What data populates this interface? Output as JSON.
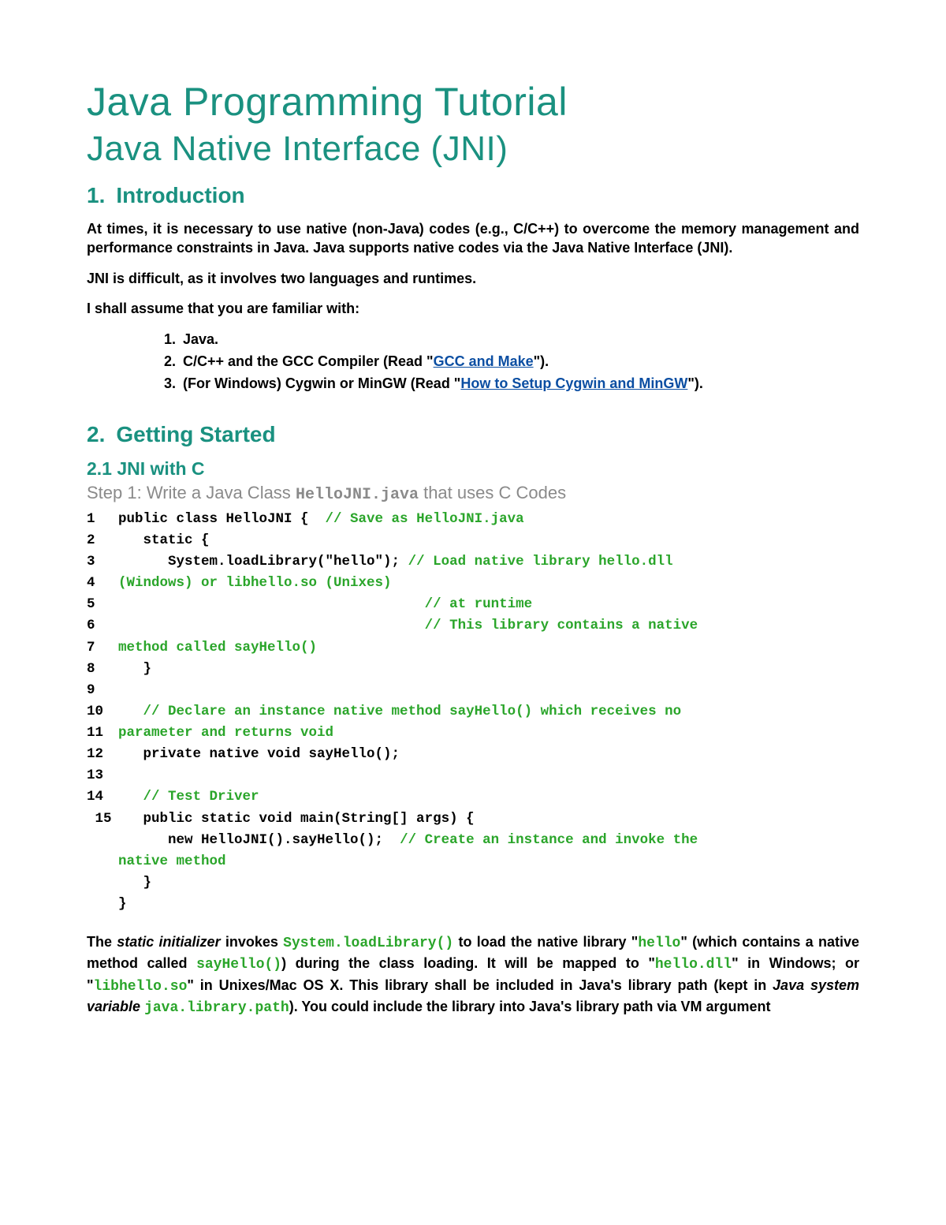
{
  "title": "Java Programming Tutorial",
  "subtitle": "Java Native Interface (JNI)",
  "section1": {
    "num": "1.",
    "label": "Introduction"
  },
  "intro": {
    "p1": "At times, it is necessary to use native (non-Java) codes (e.g., C/C++) to overcome the memory management and performance constraints in Java. Java supports native codes via the Java Native Interface (JNI).",
    "p2": "JNI is difficult, as it involves two languages and runtimes.",
    "p3": "I shall assume that you are familiar with:"
  },
  "prereq": {
    "i1": "Java.",
    "i2a": "C/C++ and the GCC Compiler (Read \"",
    "i2link": "GCC and Make",
    "i2b": "\").",
    "i3a": "(For Windows) Cygwin or MinGW (Read \"",
    "i3link": "How to Setup Cygwin and MinGW",
    "i3b": "\")."
  },
  "section2": {
    "num": "2.",
    "label": "Getting Started"
  },
  "sub21": "2.1  JNI with C",
  "step1": {
    "pre": "Step 1: Write a Java Class ",
    "code": "HelloJNI.java",
    "post": " that uses C Codes"
  },
  "code": {
    "l1a": "public class HelloJNI {  ",
    "l1b": "// Save as HelloJNI.java",
    "l2": "   static {",
    "l3a": "      System.loadLibrary(\"hello\"); ",
    "l3b": "// Load native library hello.dll",
    "l4": "(Windows) or libhello.so (Unixes)",
    "l5": "                                     // at runtime",
    "l6": "                                     // This library contains a native",
    "l7": "method called sayHello()",
    "l8": "   }",
    "l9": "",
    "l10": "   // Declare an instance native method sayHello() which receives no",
    "l11": "parameter and returns void",
    "l12": "   private native void sayHello();",
    "l13": "",
    "l14": "   // Test Driver",
    "l15": "   public static void main(String[] args) {",
    "l16a": "      new HelloJNI().sayHello();  ",
    "l16b": "// Create an instance and invoke the",
    "l17": "native method",
    "l18": "   }",
    "l19": "}"
  },
  "explain": {
    "t1": "The ",
    "static_init": "static initializer",
    "t2": " invokes ",
    "loadlib": "System.loadLibrary()",
    "t3": " to load the native library \"",
    "hello": "hello",
    "t4": "\" (which contains a native method called ",
    "sayhello": "sayHello()",
    "t5": ") during the class loading. It will be mapped to \"",
    "hellodll": "hello.dll",
    "t6": "\" in Windows; or \"",
    "libhello": "libhello.so",
    "t7": "\" in Unixes/Mac OS X. This library shall be included in Java's library path (kept in ",
    "jsv": "Java system variable",
    "sp": " ",
    "jlp": "java.library.path",
    "t8": "). You could include the library into Java's library path via VM argument"
  }
}
